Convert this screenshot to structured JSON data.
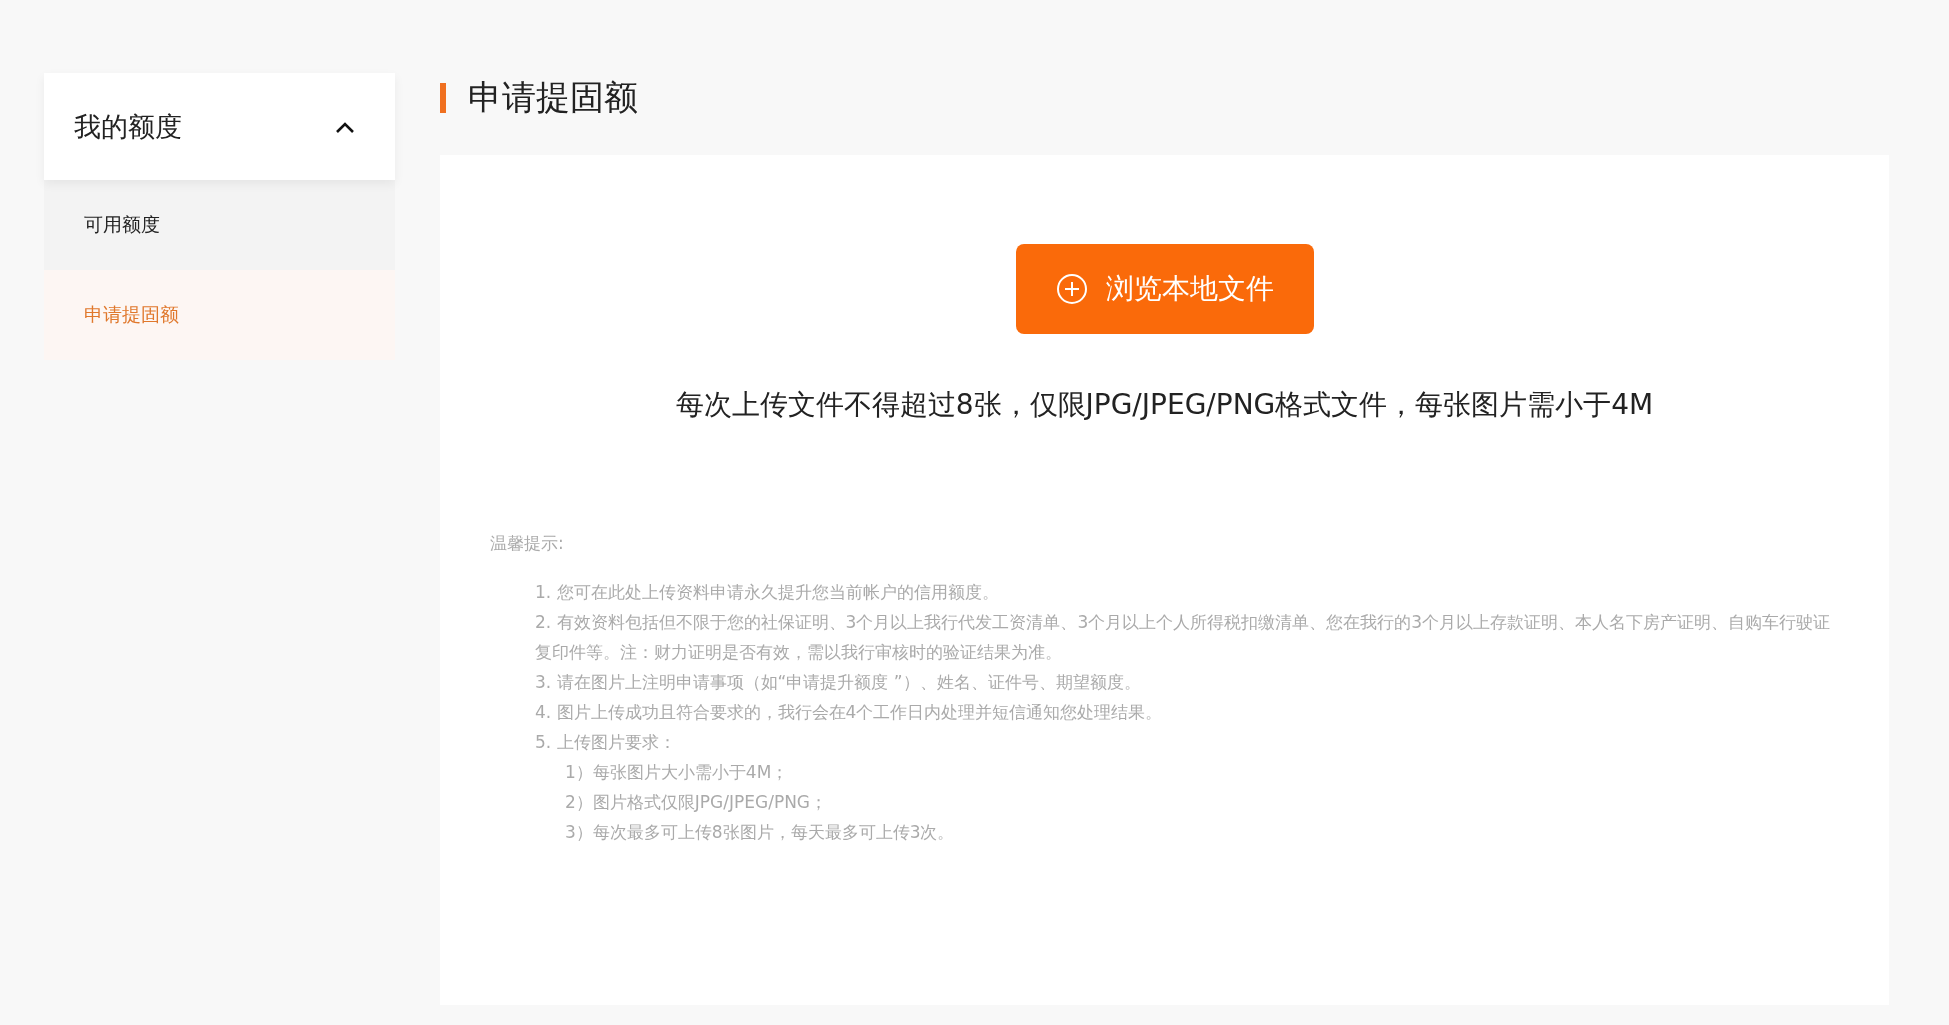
{
  "sidebar": {
    "group": {
      "title": "我的额度",
      "expanded": true
    },
    "items": [
      {
        "label": "可用额度",
        "selected": false
      },
      {
        "label": "申请提固额",
        "selected": true
      }
    ]
  },
  "main": {
    "title": "申请提固额",
    "upload_button": {
      "label": "浏览本地文件"
    },
    "upload_note": "每次上传文件不得超过8张，仅限JPG/JPEG/PNG格式文件，每张图片需小于4M",
    "tips": {
      "title": "温馨提示:",
      "items": [
        {
          "text": "1. 您可在此处上传资料申请永久提升您当前帐户的信用额度。"
        },
        {
          "text": "2. 有效资料包括但不限于您的社保证明、3个月以上我行代发工资清单、3个月以上个人所得税扣缴清单、您在我行的3个月以上存款证明、本人名下房产证明、自购车行驶证复印件等。注：财力证明是否有效，需以我行审核时的验证结果为准。"
        },
        {
          "text": "3. 请在图片上注明申请事项（如“申请提升额度 ”）、姓名、证件号、期望额度。"
        },
        {
          "text": "4. 图片上传成功且符合要求的，我行会在4个工作日内处理并短信通知您处理结果。"
        },
        {
          "text": "5. 上传图片要求：",
          "children": [
            {
              "text": "1）每张图片大小需小于4M；"
            },
            {
              "text": "2）图片格式仅限JPG/JPEG/PNG；"
            },
            {
              "text": "3）每次最多可上传8张图片，每天最多可上传3次。"
            }
          ]
        }
      ]
    }
  }
}
